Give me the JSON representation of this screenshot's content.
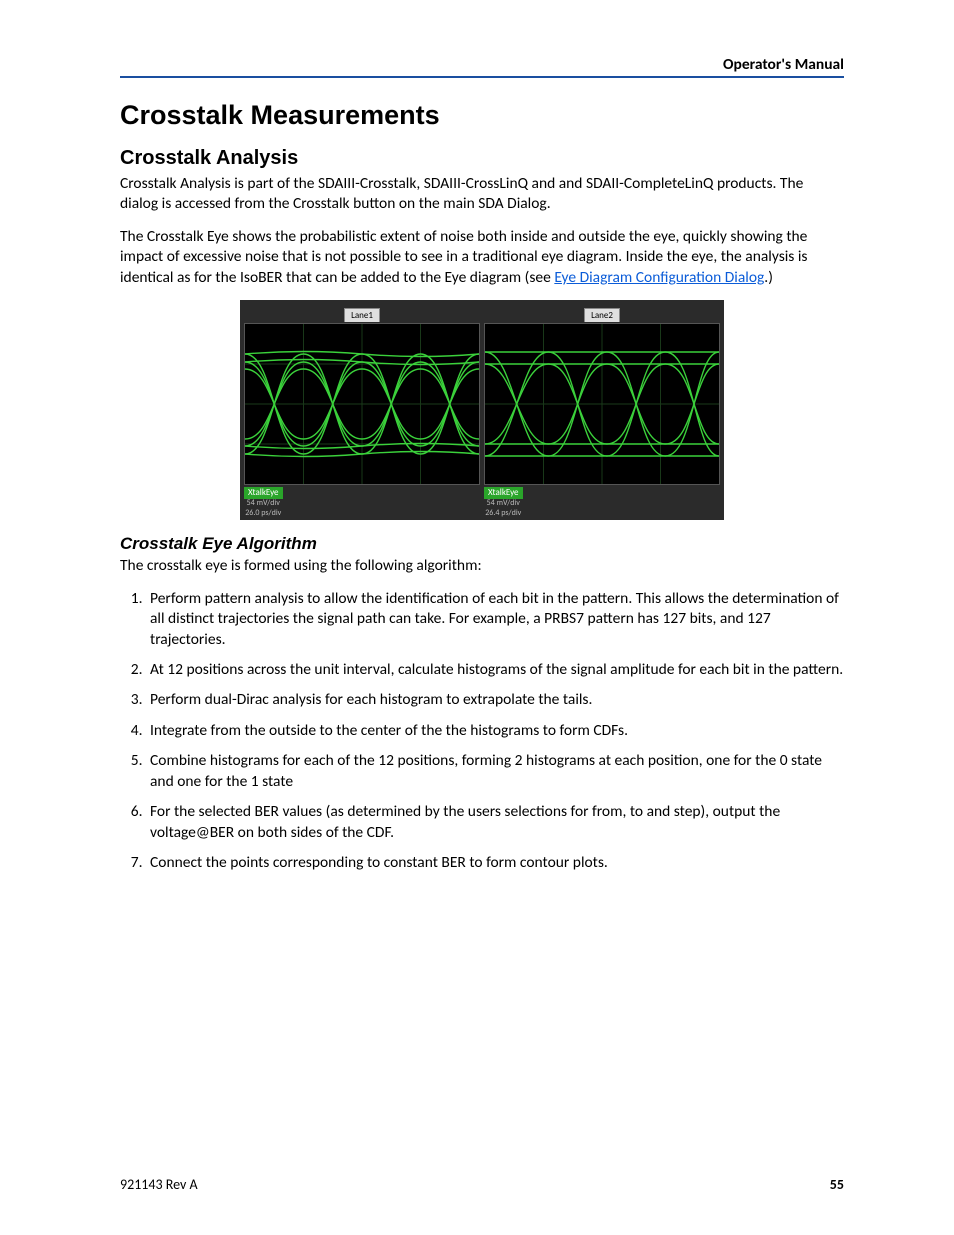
{
  "header": {
    "running": "Operator's Manual"
  },
  "h1": "Crosstalk Measurements",
  "h2": "Crosstalk Analysis",
  "p1": "Crosstalk Analysis is part of the SDAIII-Crosstalk, SDAIII-CrossLinQ and and SDAII-CompleteLinQ products. The dialog is accessed from the Crosstalk button on the main SDA Dialog.",
  "p2a": "The Crosstalk Eye shows the probabilistic extent of noise both inside and outside the eye, quickly showing the impact of excessive noise that is not possible to see in a traditional eye diagram. Inside the eye, the analysis is identical as for the IsoBER that can be added to the Eye diagram (see ",
  "p2_link": "Eye Diagram Configuration Dialog",
  "p2b": ".)",
  "fig": {
    "lane1": {
      "tab": "Lane1",
      "badge": "XtalkEye",
      "scale1": "54 mV/div",
      "scale2": "26.0 ps/div"
    },
    "lane2": {
      "tab": "Lane2",
      "badge": "XtalkEye",
      "scale1": "54 mV/div",
      "scale2": "26.4 ps/div"
    }
  },
  "h3": "Crosstalk Eye Algorithm",
  "p3": "The crosstalk eye is formed using the following algorithm:",
  "steps": [
    "Perform pattern analysis to allow the identification of each bit in the pattern. This allows the determination of all distinct trajectories the signal path can take. For example, a PRBS7 pattern has 127 bits, and 127 trajectories.",
    "At 12 positions across the unit interval, calculate histograms of the signal amplitude for each bit in the pattern.",
    "Perform dual-Dirac analysis for each histogram to extrapolate the tails.",
    "Integrate from the outside to the center of the the histograms to form CDFs.",
    "Combine histograms for each of the 12 positions, forming 2 histograms at each position, one for the 0 state and one for the 1 state",
    "For the selected BER values (as determined by the users selections for from, to and step), output the voltage@BER on both sides of the CDF.",
    "Connect the points corresponding to constant BER to form contour plots."
  ],
  "footer": {
    "doc": "921143 Rev A",
    "page": "55"
  }
}
